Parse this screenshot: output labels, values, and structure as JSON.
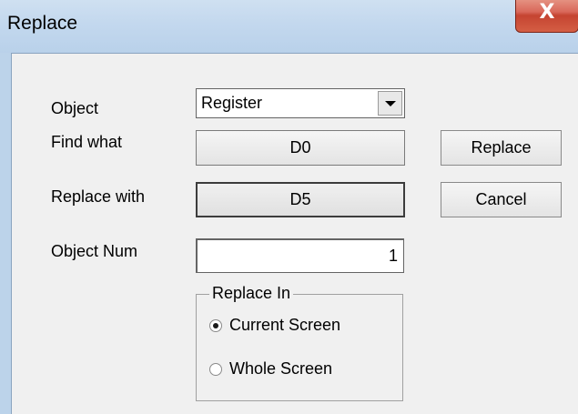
{
  "window": {
    "title": "Replace",
    "close_symbol": "X"
  },
  "form": {
    "object_label": "Object",
    "object_value": "Register",
    "find_label": "Find what",
    "find_value": "D0",
    "replace_with_label": "Replace with",
    "replace_with_value": "D5",
    "object_num_label": "Object Num",
    "object_num_value": "1"
  },
  "buttons": {
    "replace": "Replace",
    "cancel": "Cancel"
  },
  "replace_in": {
    "title": "Replace In",
    "options": [
      {
        "label": "Current Screen",
        "selected": true
      },
      {
        "label": "Whole Screen",
        "selected": false
      }
    ]
  },
  "icons": [
    "close-icon",
    "chevron-down-icon",
    "radio-selected-icon",
    "radio-unselected-icon"
  ],
  "colors": {
    "titlebar": "#c3d8ee",
    "close_button": "#c54431",
    "dialog_background": "#f0f0f0"
  }
}
